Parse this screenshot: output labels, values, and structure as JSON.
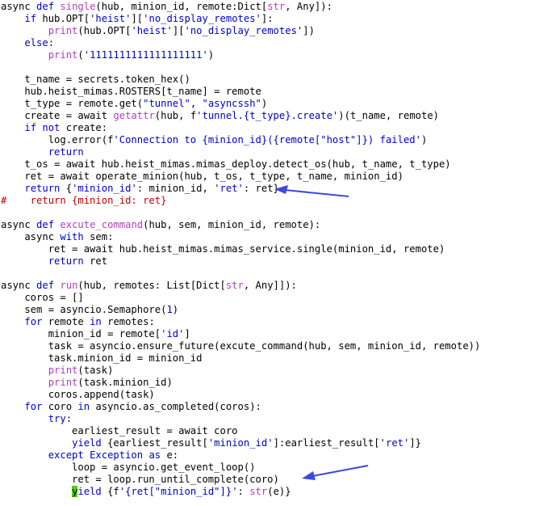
{
  "editor": {
    "accent_colors": {
      "keyword": "#0000c8",
      "builtin": "#b040c0",
      "string": "#0000c8",
      "comment": "#c00000",
      "highlight": "#4cd000",
      "arrow": "#3a49e0"
    },
    "lines": [
      [
        [
          "t",
          "async "
        ],
        [
          "k",
          "def "
        ],
        [
          "f",
          "single"
        ],
        [
          "t",
          "(hub, minion_id, remote:Dict["
        ],
        [
          "f",
          "str"
        ],
        [
          "t",
          ", Any]):"
        ]
      ],
      [
        [
          "t",
          "    "
        ],
        [
          "k",
          "if "
        ],
        [
          "t",
          "hub.OPT["
        ],
        [
          "s",
          "'heist'"
        ],
        [
          "t",
          "]["
        ],
        [
          "s",
          "'no_display_remotes'"
        ],
        [
          "t",
          "]:"
        ]
      ],
      [
        [
          "t",
          "        "
        ],
        [
          "f",
          "print"
        ],
        [
          "t",
          "(hub.OPT["
        ],
        [
          "s",
          "'heist'"
        ],
        [
          "t",
          "]["
        ],
        [
          "s",
          "'no_display_remotes'"
        ],
        [
          "t",
          "])"
        ]
      ],
      [
        [
          "t",
          "    "
        ],
        [
          "k",
          "else"
        ],
        [
          "t",
          ":"
        ]
      ],
      [
        [
          "t",
          "        "
        ],
        [
          "f",
          "print"
        ],
        [
          "t",
          "("
        ],
        [
          "s",
          "'1111111111111111111'"
        ],
        [
          "t",
          ")"
        ]
      ],
      [],
      [
        [
          "t",
          "    t_name = secrets.token_hex()"
        ]
      ],
      [
        [
          "t",
          "    hub.heist_mimas.ROSTERS[t_name] = remote"
        ]
      ],
      [
        [
          "t",
          "    t_type = remote.get("
        ],
        [
          "s",
          "\"tunnel\""
        ],
        [
          "t",
          ", "
        ],
        [
          "s",
          "\"asyncssh\""
        ],
        [
          "t",
          ")"
        ]
      ],
      [
        [
          "t",
          "    create = await "
        ],
        [
          "f",
          "getattr"
        ],
        [
          "t",
          "(hub, f"
        ],
        [
          "s",
          "'tunnel.{t_type}.create'"
        ],
        [
          "t",
          ")(t_name, remote)"
        ]
      ],
      [
        [
          "t",
          "    "
        ],
        [
          "k",
          "if not "
        ],
        [
          "t",
          "create:"
        ]
      ],
      [
        [
          "t",
          "        log.error(f"
        ],
        [
          "s",
          "'Connection to {minion_id}({remote[\"host\"]}) failed'"
        ],
        [
          "t",
          ")"
        ]
      ],
      [
        [
          "t",
          "        "
        ],
        [
          "k",
          "return"
        ]
      ],
      [
        [
          "t",
          "    t_os = await hub.heist_mimas.mimas_deploy.detect_os(hub, t_name, t_type)"
        ]
      ],
      [
        [
          "t",
          "    ret = await operate_minion(hub, t_os, t_type, t_name, minion_id)"
        ]
      ],
      [
        [
          "t",
          "    "
        ],
        [
          "k",
          "return "
        ],
        [
          "t",
          "{"
        ],
        [
          "s",
          "'minion_id'"
        ],
        [
          "t",
          ": minion_id, "
        ],
        [
          "s",
          "'ret'"
        ],
        [
          "t",
          ": ret}"
        ]
      ],
      [
        [
          "c",
          "#    return {minion_id: ret}"
        ]
      ],
      [],
      [
        [
          "t",
          "async "
        ],
        [
          "k",
          "def "
        ],
        [
          "f",
          "excute_command"
        ],
        [
          "t",
          "(hub, sem, minion_id, remote):"
        ]
      ],
      [
        [
          "t",
          "    async "
        ],
        [
          "k",
          "with "
        ],
        [
          "t",
          "sem:"
        ]
      ],
      [
        [
          "t",
          "        ret = await hub.heist_mimas.mimas_service.single(minion_id, remote)"
        ]
      ],
      [
        [
          "t",
          "        "
        ],
        [
          "k",
          "return "
        ],
        [
          "t",
          "ret"
        ]
      ],
      [],
      [
        [
          "t",
          "async "
        ],
        [
          "k",
          "def "
        ],
        [
          "f",
          "run"
        ],
        [
          "t",
          "(hub, remotes: List[Dict["
        ],
        [
          "f",
          "str"
        ],
        [
          "t",
          ", Any]]):"
        ]
      ],
      [
        [
          "t",
          "    coros = []"
        ]
      ],
      [
        [
          "t",
          "    sem = asyncio.Semaphore("
        ],
        [
          "s",
          "1"
        ],
        [
          "t",
          ")"
        ]
      ],
      [
        [
          "t",
          "    "
        ],
        [
          "k",
          "for "
        ],
        [
          "t",
          "remote "
        ],
        [
          "k",
          "in "
        ],
        [
          "t",
          "remotes:"
        ]
      ],
      [
        [
          "t",
          "        minion_id = remote["
        ],
        [
          "s",
          "'id'"
        ],
        [
          "t",
          "]"
        ]
      ],
      [
        [
          "t",
          "        task = asyncio.ensure_future(excute_command(hub, sem, minion_id, remote))"
        ]
      ],
      [
        [
          "t",
          "        task.minion_id = minion_id"
        ]
      ],
      [
        [
          "t",
          "        "
        ],
        [
          "f",
          "print"
        ],
        [
          "t",
          "(task)"
        ]
      ],
      [
        [
          "t",
          "        "
        ],
        [
          "f",
          "print"
        ],
        [
          "t",
          "(task.minion_id)"
        ]
      ],
      [
        [
          "t",
          "        coros.append(task)"
        ]
      ],
      [
        [
          "t",
          "    "
        ],
        [
          "k",
          "for "
        ],
        [
          "t",
          "coro "
        ],
        [
          "k",
          "in "
        ],
        [
          "t",
          "asyncio.as_completed(coros):"
        ]
      ],
      [
        [
          "t",
          "        "
        ],
        [
          "k",
          "try"
        ],
        [
          "t",
          ":"
        ]
      ],
      [
        [
          "t",
          "            earliest_result = await coro"
        ]
      ],
      [
        [
          "t",
          "            "
        ],
        [
          "k",
          "yield "
        ],
        [
          "t",
          "{earliest_result["
        ],
        [
          "s",
          "'minion_id'"
        ],
        [
          "t",
          "]:earliest_result["
        ],
        [
          "s",
          "'ret'"
        ],
        [
          "t",
          "]}"
        ]
      ],
      [
        [
          "t",
          "        "
        ],
        [
          "k",
          "except Exception as "
        ],
        [
          "t",
          "e:"
        ]
      ],
      [
        [
          "t",
          "            loop = asyncio.get_event_loop()"
        ]
      ],
      [
        [
          "t",
          "            ret = loop.run_until_complete(coro)"
        ]
      ],
      [
        [
          "t",
          "            "
        ],
        [
          "h",
          "y"
        ],
        [
          "k",
          "ield "
        ],
        [
          "t",
          "{f"
        ],
        [
          "s",
          "'{ret[\"minion_id\"]}'"
        ],
        [
          "t",
          ": "
        ],
        [
          "f",
          "str"
        ],
        [
          "t",
          "(e)}"
        ]
      ]
    ]
  }
}
